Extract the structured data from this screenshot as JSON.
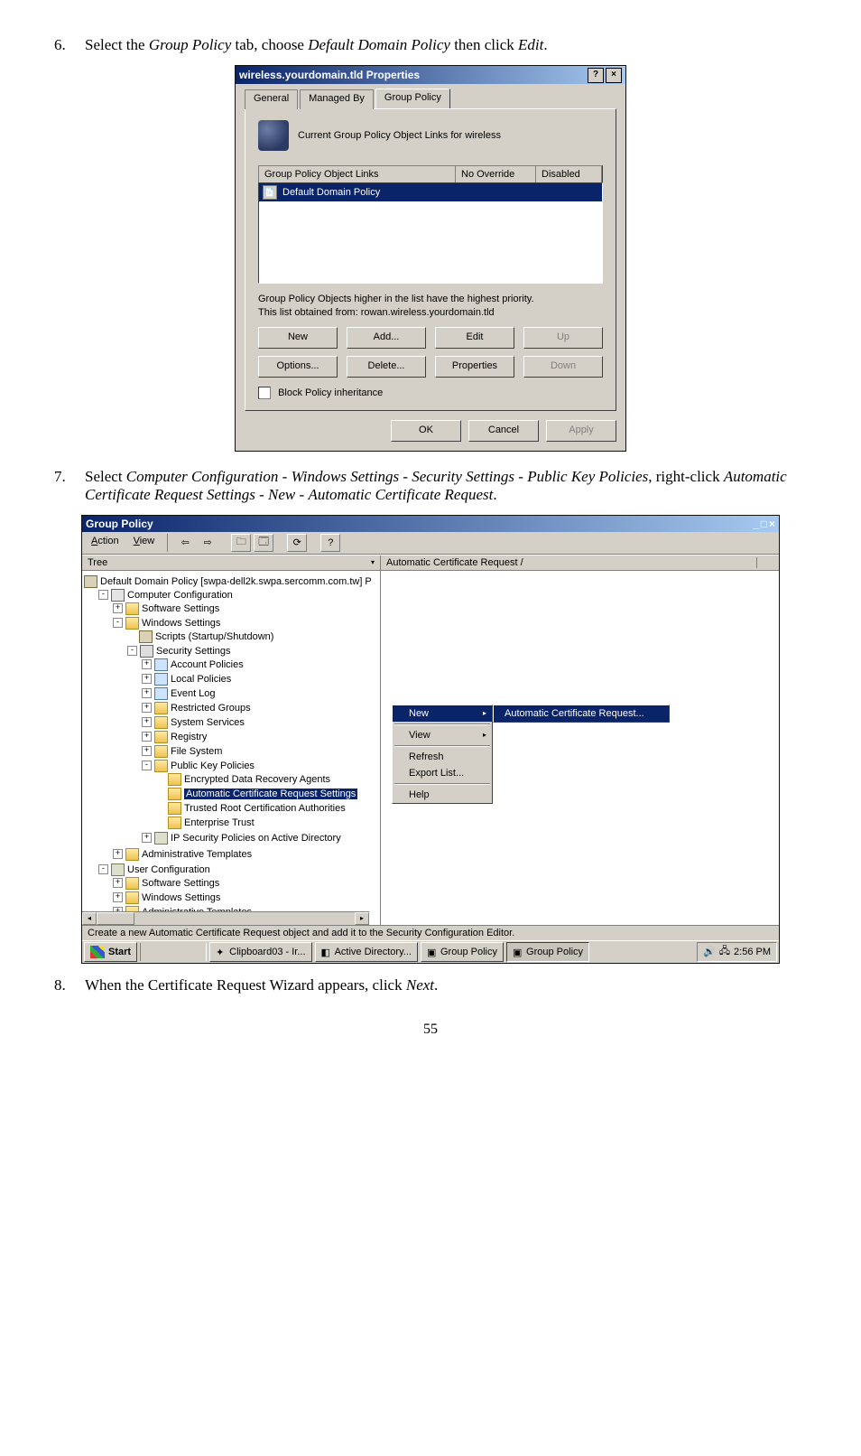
{
  "steps": {
    "s6": {
      "num": "6.",
      "pre": "Select the ",
      "i1": "Group Policy",
      "mid1": " tab, choose ",
      "i2": "Default Domain Policy",
      "mid2": " then click ",
      "i3": "Edit",
      "post": "."
    },
    "s7": {
      "num": "7.",
      "pre": "Select ",
      "i1": "Computer Configuration",
      "d": " - ",
      "i2": "Windows Settings",
      "i3": "Security Settings",
      "i4": "Public Key Policies",
      "mid": ", right-click ",
      "i5": "Automatic Certificate Request Settings",
      "i6": "New",
      "i7": "Automatic Certificate Request",
      "post": "."
    },
    "s8": {
      "num": "8.",
      "pre": "When the Certificate Request Wizard appears, click ",
      "i1": "Next",
      "post": "."
    }
  },
  "chart_data": {
    "dlg": {
      "title": "wireless.yourdomain.tld Properties",
      "help": "?",
      "close": "×",
      "tabs": {
        "general": "General",
        "managed": "Managed By",
        "gp": "Group Policy"
      },
      "linksdesc": "Current Group Policy Object Links for wireless",
      "cols": {
        "links": "Group Policy Object Links",
        "noov": "No Override",
        "dis": "Disabled"
      },
      "row1": "Default Domain Policy",
      "hint1": "Group Policy Objects higher in the list have the highest priority.",
      "hint2": "This list obtained from: rowan.wireless.yourdomain.tld",
      "btns": {
        "new": "New",
        "add": "Add...",
        "edit": "Edit",
        "up": "Up",
        "options": "Options...",
        "delete": "Delete...",
        "props": "Properties",
        "down": "Down"
      },
      "block": "Block Policy inheritance",
      "ok": "OK",
      "cancel": "Cancel",
      "apply": "Apply"
    },
    "mmc": {
      "title": "Group Policy",
      "min": "_",
      "max": "□",
      "close": "×",
      "menu": {
        "action": "Action",
        "view": "View"
      },
      "treehead": "Tree",
      "righthead": "Automatic Certificate Request    /",
      "tree": {
        "root": "Default Domain Policy [swpa-dell2k.swpa.sercomm.com.tw] P",
        "cc": "Computer Configuration",
        "ss": "Software Settings",
        "ws": "Windows Settings",
        "scripts": "Scripts (Startup/Shutdown)",
        "sec": "Security Settings",
        "acct": "Account Policies",
        "local": "Local Policies",
        "evlog": "Event Log",
        "rg": "Restricted Groups",
        "sysvc": "System Services",
        "reg": "Registry",
        "fs": "File System",
        "pkp": "Public Key Policies",
        "edra": "Encrypted Data Recovery Agents",
        "acrs": "Automatic Certificate Request Settings",
        "trca": "Trusted Root Certification Authorities",
        "et": "Enterprise Trust",
        "ipsec": "IP Security Policies on Active Directory",
        "adm": "Administrative Templates",
        "uc": "User Configuration",
        "uss": "Software Settings",
        "uws": "Windows Settings",
        "uadm": "Administrative Templates"
      },
      "ctx": {
        "new": "New",
        "view": "View",
        "refresh": "Refresh",
        "export": "Export List...",
        "help": "Help"
      },
      "sub": {
        "acr": "Automatic Certificate Request..."
      },
      "status": "Create a new Automatic Certificate Request object and add it to the Security Configuration Editor."
    },
    "taskbar": {
      "start": "Start",
      "t1": "Clipboard03 - Ir...",
      "t2": "Active Directory...",
      "t3": "Group Policy",
      "t4": "Group Policy",
      "clock": "2:56 PM"
    }
  },
  "page": "55"
}
